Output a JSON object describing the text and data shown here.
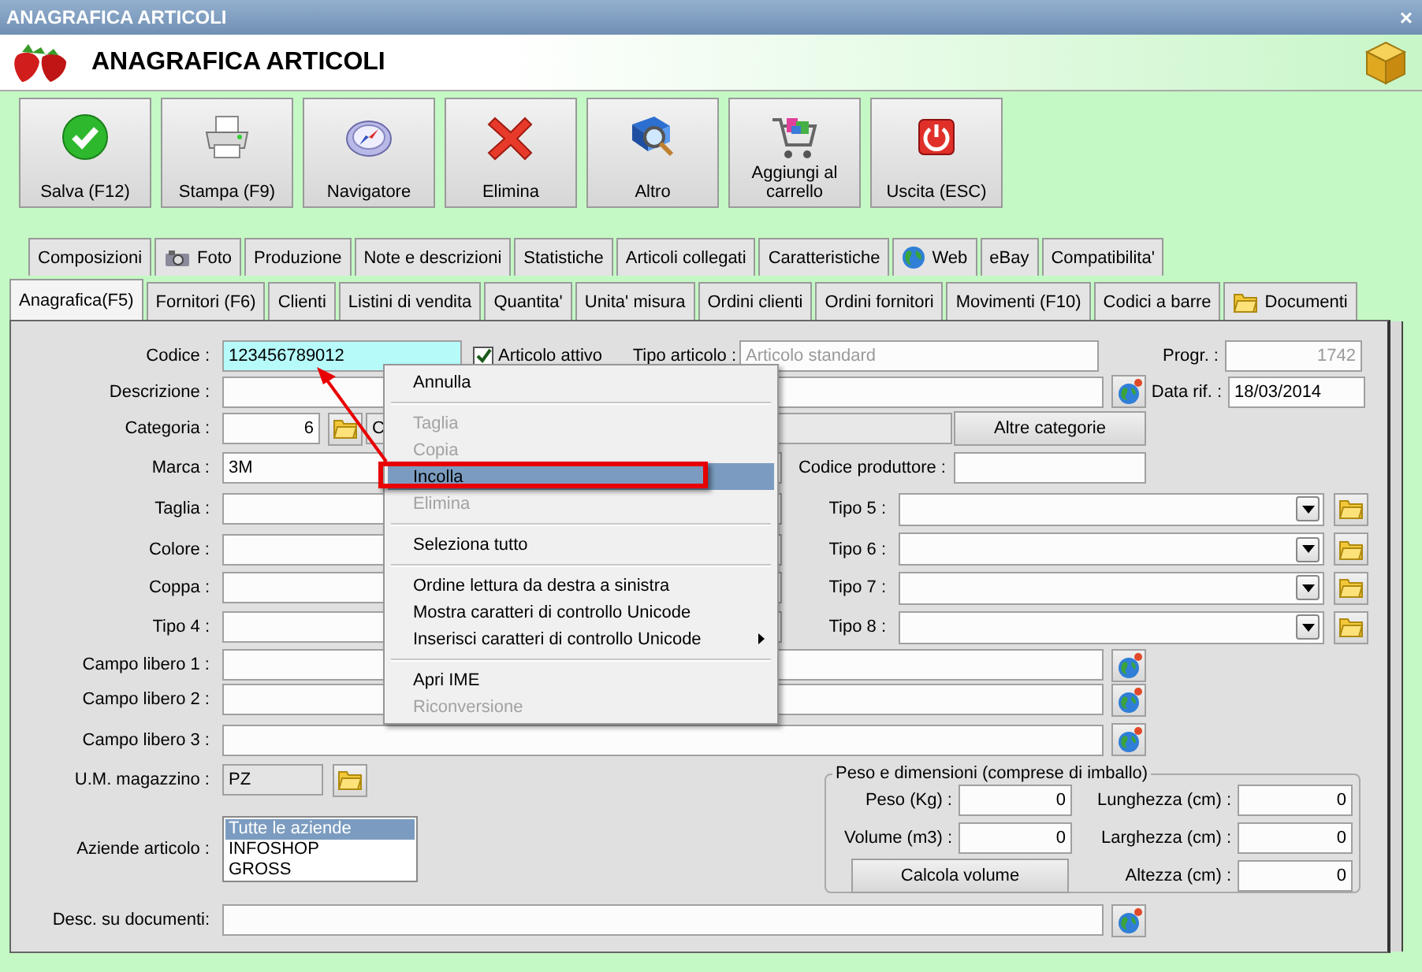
{
  "window": {
    "title": "ANAGRAFICA ARTICOLI",
    "close": "×"
  },
  "header": {
    "title": "ANAGRAFICA ARTICOLI"
  },
  "toolbar": [
    {
      "label": "Salva (F12)",
      "kind": "save"
    },
    {
      "label": "Stampa (F9)",
      "kind": "print"
    },
    {
      "label": "Navigatore",
      "kind": "compass"
    },
    {
      "label": "Elimina",
      "kind": "delete"
    },
    {
      "label": "Altro",
      "kind": "search"
    },
    {
      "label": "Aggiungi al carrello",
      "kind": "cart"
    },
    {
      "label": "Uscita (ESC)",
      "kind": "exit"
    }
  ],
  "tabs_top": [
    {
      "label": "Composizioni",
      "kind": "plain",
      "selected": false
    },
    {
      "label": "Foto",
      "kind": "camera",
      "selected": false
    },
    {
      "label": "Produzione",
      "kind": "plain",
      "selected": false
    },
    {
      "label": "Note e descrizioni",
      "kind": "plain",
      "selected": false
    },
    {
      "label": "Statistiche",
      "kind": "plain",
      "selected": false
    },
    {
      "label": "Articoli collegati",
      "kind": "plain",
      "selected": false
    },
    {
      "label": "Caratteristiche",
      "kind": "plain",
      "selected": false
    },
    {
      "label": "Web",
      "kind": "globe",
      "selected": false
    },
    {
      "label": "eBay",
      "kind": "plain",
      "selected": false
    },
    {
      "label": "Compatibilita'",
      "kind": "plain",
      "selected": false
    }
  ],
  "tabs_bottom": [
    {
      "label": "Anagrafica(F5)",
      "kind": "plain",
      "selected": true
    },
    {
      "label": "Fornitori (F6)",
      "kind": "plain",
      "selected": false
    },
    {
      "label": "Clienti",
      "kind": "plain",
      "selected": false
    },
    {
      "label": "Listini di vendita",
      "kind": "plain",
      "selected": false
    },
    {
      "label": "Quantita'",
      "kind": "plain",
      "selected": false
    },
    {
      "label": "Unita' misura",
      "kind": "plain",
      "selected": false
    },
    {
      "label": "Ordini clienti",
      "kind": "plain",
      "selected": false
    },
    {
      "label": "Ordini fornitori",
      "kind": "plain",
      "selected": false
    },
    {
      "label": "Movimenti (F10)",
      "kind": "plain",
      "selected": false
    },
    {
      "label": "Codici a barre",
      "kind": "plain",
      "selected": false
    },
    {
      "label": "Documenti",
      "kind": "folder",
      "selected": false
    }
  ],
  "form": {
    "codice": {
      "label": "Codice :",
      "value": "123456789012"
    },
    "articolo_attivo": {
      "label": "Articolo attivo",
      "checked": true
    },
    "tipo_articolo": {
      "label": "Tipo articolo :",
      "value": "Articolo standard",
      "disabled": true
    },
    "progr": {
      "label": "Progr. :",
      "value": "1742",
      "disabled": true
    },
    "descrizione": {
      "label": "Descrizione :"
    },
    "data_rif": {
      "label": "Data rif. :",
      "value": "18/03/2014"
    },
    "categoria": {
      "label": "Categoria :",
      "value": "6",
      "description": "C"
    },
    "altre_categorie": "Altre categorie",
    "marca": {
      "label": "Marca :",
      "value": "3M"
    },
    "codice_produttore": {
      "label": "Codice produttore :"
    },
    "attribute_rows": [
      {
        "left": "Taglia :",
        "right": "Tipo 5 :"
      },
      {
        "left": "Colore :",
        "right": "Tipo 6 :"
      },
      {
        "left": "Coppa :",
        "right": "Tipo 7 :"
      },
      {
        "left": "Tipo 4 :",
        "right": "Tipo 8 :"
      }
    ],
    "free_fields": [
      {
        "label": "Campo libero 1 :"
      },
      {
        "label": "Campo libero 2 :"
      },
      {
        "label": "Campo libero 3 :"
      }
    ],
    "um": {
      "label": "U.M. magazzino :",
      "value": "PZ"
    },
    "aziende": {
      "label": "Aziende articolo :",
      "items": [
        {
          "label": "Tutte le aziende",
          "selected": true
        },
        {
          "label": "INFOSHOP",
          "selected": false
        },
        {
          "label": "GROSS",
          "selected": false
        }
      ]
    },
    "peso": {
      "title": "Peso e dimensioni (comprese di imballo)",
      "left_fields": [
        {
          "label": "Peso (Kg) :",
          "value": "0"
        },
        {
          "label": "Volume (m3) :",
          "value": "0"
        }
      ],
      "right_fields": [
        {
          "label": "Lunghezza (cm) :",
          "value": "0"
        },
        {
          "label": "Larghezza (cm) :",
          "value": "0"
        },
        {
          "label": "Altezza (cm) :",
          "value": "0"
        }
      ],
      "button": "Calcola volume"
    },
    "desc_documenti": {
      "label": "Desc. su documenti:"
    }
  },
  "context_menu": {
    "items": [
      {
        "kind": "item",
        "label": "Annulla",
        "disabled": false,
        "selected": false
      },
      {
        "kind": "separator"
      },
      {
        "kind": "item",
        "label": "Taglia",
        "disabled": true,
        "selected": false
      },
      {
        "kind": "item",
        "label": "Copia",
        "disabled": true,
        "selected": false
      },
      {
        "kind": "item",
        "label": "Incolla",
        "disabled": false,
        "selected": true
      },
      {
        "kind": "item",
        "label": "Elimina",
        "disabled": true,
        "selected": false
      },
      {
        "kind": "separator"
      },
      {
        "kind": "item",
        "label": "Seleziona tutto",
        "disabled": false,
        "selected": false
      },
      {
        "kind": "separator"
      },
      {
        "kind": "item",
        "label": "Ordine lettura da destra a sinistra",
        "disabled": false,
        "selected": false
      },
      {
        "kind": "item",
        "label": "Mostra caratteri di controllo Unicode",
        "disabled": false,
        "selected": false
      },
      {
        "kind": "submenu",
        "label": "Inserisci caratteri di controllo Unicode",
        "disabled": false,
        "selected": false
      },
      {
        "kind": "separator"
      },
      {
        "kind": "item",
        "label": "Apri IME",
        "disabled": false,
        "selected": false
      },
      {
        "kind": "item",
        "label": "Riconversione",
        "disabled": true,
        "selected": false
      }
    ]
  }
}
